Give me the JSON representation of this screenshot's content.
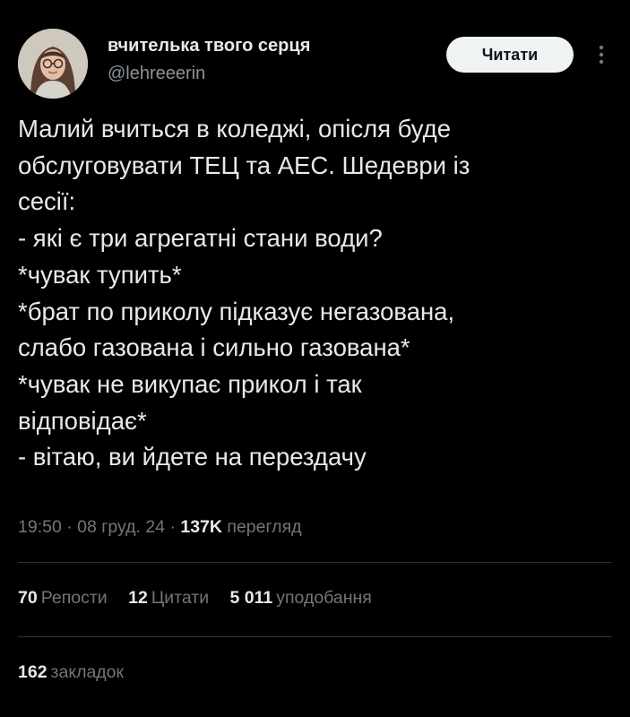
{
  "author": {
    "display_name": "вчителька твого серця",
    "handle": "@lehreeerin",
    "follow_label": "Читати"
  },
  "tweet": {
    "text": "Малий вчиться в коледжі, опісля буде\nобслуговувати ТЕЦ та АЕС. Шедеври із\nсесії:\n- які є три агрегатні стани води?\n*чувак тупить*\n*брат по приколу підказує негазована,\nслабо газована і сильно газована*\n*чувак не викупає прикол і так\nвідповідає*\n- вітаю, ви йдете на перездачу",
    "time": "19:50",
    "date": "08 груд. 24",
    "views_count": "137K",
    "views_label": "перегляд",
    "separator": "·"
  },
  "stats": {
    "reposts_count": "70",
    "reposts_label": "Репости",
    "quotes_count": "12",
    "quotes_label": "Цитати",
    "likes_count": "5 011",
    "likes_label": "уподобання",
    "bookmarks_count": "162",
    "bookmarks_label": "закладок"
  },
  "icons": {
    "more": "more-vertical-icon"
  },
  "colors": {
    "background": "#000000",
    "text_primary": "#e7e9ea",
    "text_secondary": "#71767b",
    "button_bg": "#eff3f4",
    "divider": "#2f3336"
  }
}
